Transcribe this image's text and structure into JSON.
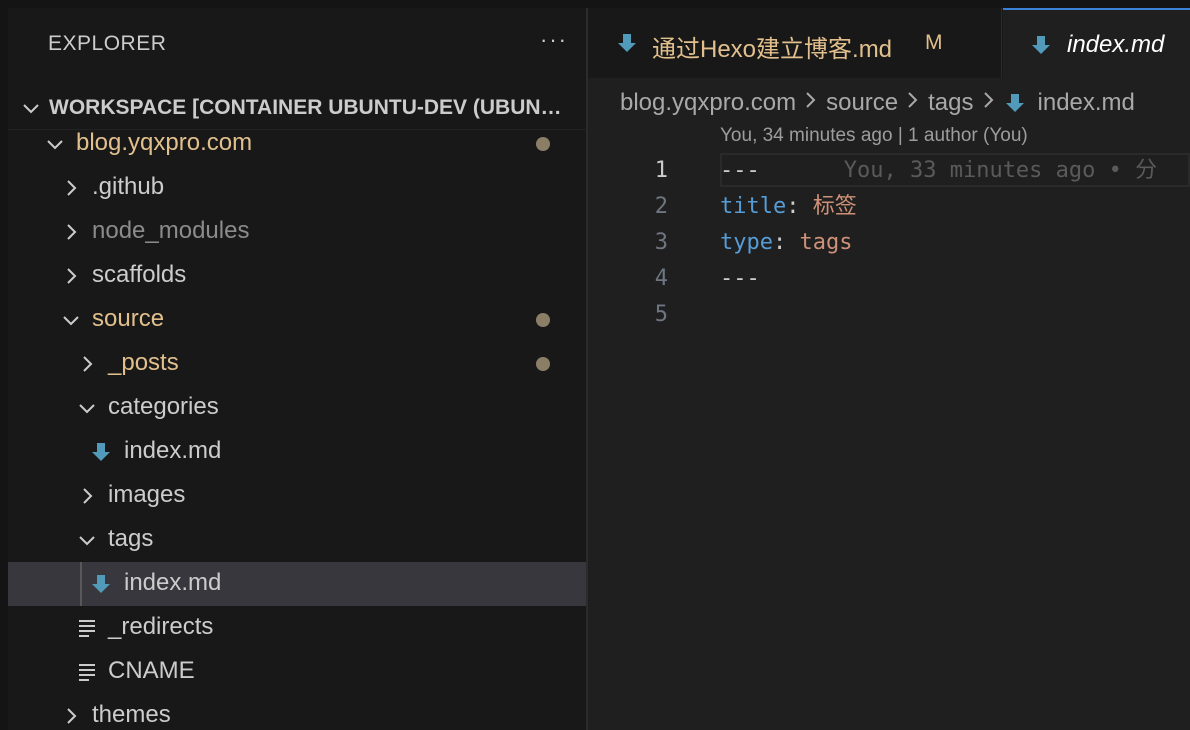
{
  "sidebar": {
    "title": "EXPLORER",
    "more_label": "···",
    "workspace_title": "WORKSPACE [CONTAINER UBUNTU-DEV (UBUNTU)]",
    "tree": [
      {
        "label": "blog.yqxpro.com",
        "depth": 0,
        "kind": "folder-open",
        "state": "mod",
        "dot": true
      },
      {
        "label": ".github",
        "depth": 1,
        "kind": "folder-closed",
        "state": "normal"
      },
      {
        "label": "node_modules",
        "depth": 1,
        "kind": "folder-closed",
        "state": "dim"
      },
      {
        "label": "scaffolds",
        "depth": 1,
        "kind": "folder-closed",
        "state": "normal"
      },
      {
        "label": "source",
        "depth": 1,
        "kind": "folder-open",
        "state": "mod",
        "dot": true
      },
      {
        "label": "_posts",
        "depth": 2,
        "kind": "folder-closed",
        "state": "mod",
        "dot": true
      },
      {
        "label": "categories",
        "depth": 2,
        "kind": "folder-open",
        "state": "normal"
      },
      {
        "label": "index.md",
        "depth": 3,
        "kind": "markdown-file",
        "state": "normal"
      },
      {
        "label": "images",
        "depth": 2,
        "kind": "folder-closed",
        "state": "normal"
      },
      {
        "label": "tags",
        "depth": 2,
        "kind": "folder-open",
        "state": "normal"
      },
      {
        "label": "index.md",
        "depth": 3,
        "kind": "markdown-file",
        "state": "normal",
        "selected": true
      },
      {
        "label": "_redirects",
        "depth": 2,
        "kind": "text-file",
        "state": "normal"
      },
      {
        "label": "CNAME",
        "depth": 2,
        "kind": "text-file",
        "state": "normal"
      },
      {
        "label": "themes",
        "depth": 1,
        "kind": "folder-closed",
        "state": "normal"
      }
    ]
  },
  "tabs": [
    {
      "label": "通过Hexo建立博客.md",
      "badge": "M",
      "icon": "markdown-icon",
      "active": false
    },
    {
      "label": "index.md",
      "icon": "markdown-icon",
      "active": true
    }
  ],
  "breadcrumb": [
    "blog.yqxpro.com",
    "source",
    "tags",
    "index.md"
  ],
  "codelens": "You, 34 minutes ago | 1 author (You)",
  "editor": {
    "line_numbers": [
      "1",
      "2",
      "3",
      "4",
      "5"
    ],
    "line1_text": "---",
    "line1_blame": "You, 33 minutes ago • 分",
    "line2_key": "title",
    "line2_colon": ":",
    "line2_value": "标签",
    "line3_key": "type",
    "line3_colon": ":",
    "line3_value": "tags",
    "line4_text": "---"
  },
  "colors": {
    "accent": "#3b82d6",
    "modified": "#e2c08d",
    "markdown_icon": "#519aba"
  }
}
